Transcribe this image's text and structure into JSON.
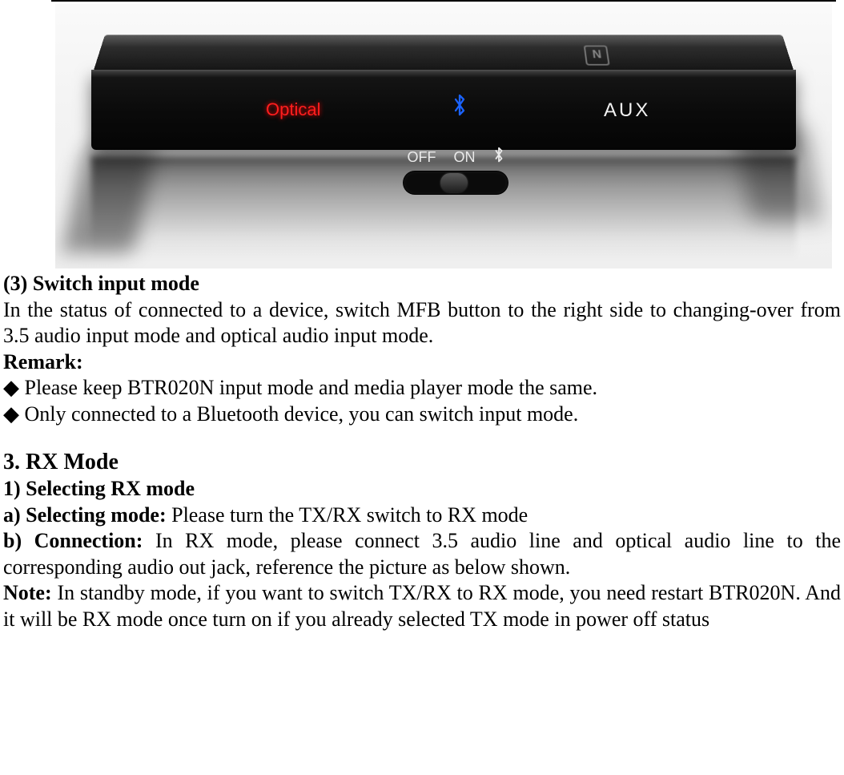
{
  "photo": {
    "nfc_text": "N",
    "label_optical": "Optical",
    "label_aux": "AUX",
    "switch_off": "OFF",
    "switch_on": "ON"
  },
  "text": {
    "h3": "(3) Switch input mode",
    "p3": "In the status of connected to a device, switch MFB button to the right side to changing-over from 3.5 audio input mode and optical audio input mode.",
    "remark_label": "Remark:",
    "remark_b1": "Please keep BTR020N input mode and media player mode the same.",
    "remark_b2": "Only connected to a Bluetooth device, you can switch input mode.",
    "section3": "3.  RX Mode",
    "h1": "1) Selecting RX mode",
    "a_label": "a) Selecting mode: ",
    "a_text": "Please turn the TX/RX switch to RX mode",
    "b_label": "b) Connection: ",
    "b_text": "In RX mode, please connect 3.5 audio line and optical audio line to the corresponding audio out jack, reference the picture as below shown.",
    "note_label": "Note: ",
    "note_text": "In standby mode, if you want to switch TX/RX to RX mode, you need restart BTR020N. And it will be RX mode once turn on if you already selected TX mode in power off status"
  }
}
